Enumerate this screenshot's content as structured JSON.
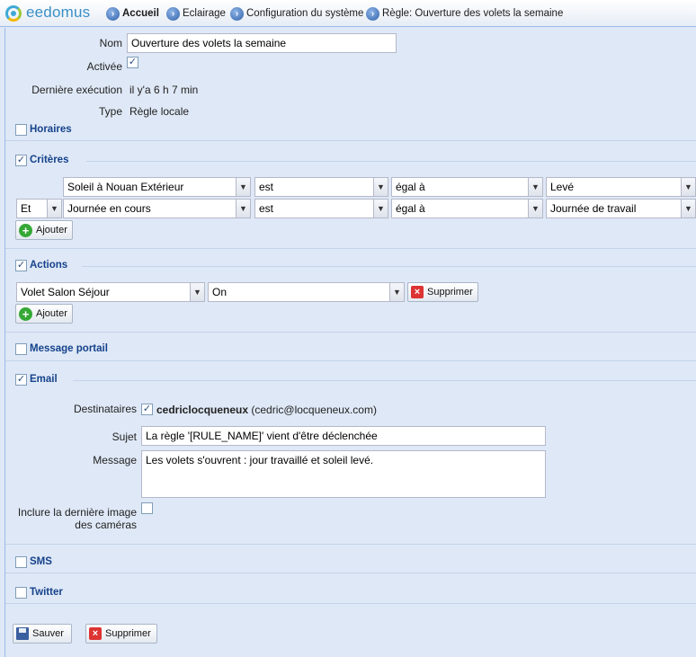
{
  "header": {
    "logo_text": "eedomus",
    "breadcrumbs": [
      {
        "label": "Accueil"
      },
      {
        "label": "Eclairage"
      },
      {
        "label": "Configuration du système"
      },
      {
        "label": "Règle: Ouverture des volets la semaine"
      }
    ]
  },
  "rule": {
    "name_label": "Nom",
    "name_value": "Ouverture des volets la semaine",
    "active_label": "Activée",
    "active_checked": true,
    "last_exec_label": "Dernière exécution",
    "last_exec_value": "il y'a 6 h 7 min",
    "type_label": "Type",
    "type_value": "Règle locale"
  },
  "sections": {
    "horaires": {
      "title": "Horaires",
      "checked": false
    },
    "criteres": {
      "title": "Critères",
      "checked": true
    },
    "actions": {
      "title": "Actions",
      "checked": true
    },
    "message_portail": {
      "title": "Message portail",
      "checked": false
    },
    "email": {
      "title": "Email",
      "checked": true
    },
    "sms": {
      "title": "SMS",
      "checked": false
    },
    "twitter": {
      "title": "Twitter",
      "checked": false
    }
  },
  "criteria": [
    {
      "connector": "",
      "device": "Soleil à Nouan Extérieur",
      "verb": "est",
      "operator": "égal à",
      "value": "Levé"
    },
    {
      "connector": "Et",
      "device": "Journée en cours",
      "verb": "est",
      "operator": "égal à",
      "value": "Journée de travail"
    }
  ],
  "criteria_add_label": "Ajouter",
  "actions": [
    {
      "device": "Volet Salon Séjour",
      "value": "On",
      "delete_label": "Supprimer"
    }
  ],
  "actions_add_label": "Ajouter",
  "email": {
    "recipients_label": "Destinataires",
    "recipient_checked": true,
    "recipient_name": "cedriclocqueneux",
    "recipient_email": "(cedric@locqueneux.com)",
    "subject_label": "Sujet",
    "subject_value": "La règle '[RULE_NAME]' vient d'être déclenchée",
    "message_label": "Message",
    "message_value": "Les volets s'ouvrent : jour travaillé et soleil levé.",
    "include_label_line1": "Inclure la dernière image",
    "include_label_line2": "des caméras",
    "include_checked": false
  },
  "footer": {
    "save_label": "Sauver",
    "delete_label": "Supprimer"
  }
}
